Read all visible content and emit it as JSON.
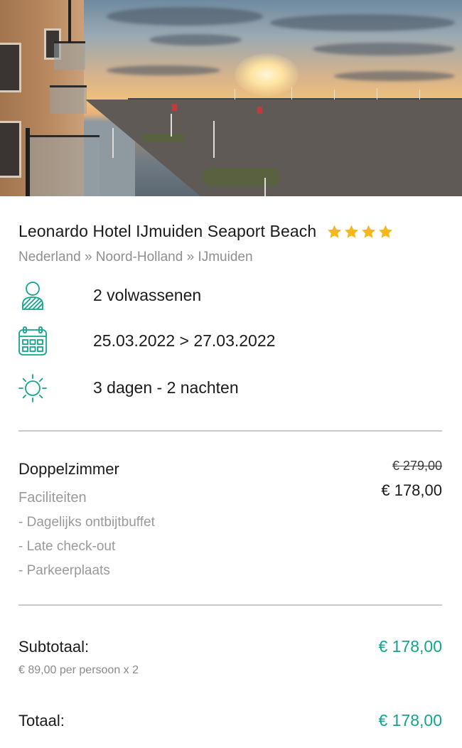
{
  "hotel": {
    "name": "Leonardo Hotel IJmuiden Seaport Beach",
    "stars": 4,
    "breadcrumb": "Nederland » Noord-Holland » IJmuiden"
  },
  "booking": {
    "guests": "2 volwassenen",
    "dates": "25.03.2022 > 27.03.2022",
    "duration": "3 dagen - 2 nachten"
  },
  "room": {
    "name": "Doppelzimmer",
    "old_price": "€ 279,00",
    "price": "€ 178,00",
    "facilities_title": "Faciliteiten",
    "facilities": [
      "- Dagelijks ontbijtbuffet",
      "- Late check-out",
      "- Parkeerplaats"
    ]
  },
  "summary": {
    "subtotal_label": "Subtotaal:",
    "subtotal_value": "€ 178,00",
    "per_person": "€ 89,00 per persoon x 2",
    "total_label": "Totaal:",
    "total_value": "€ 178,00"
  },
  "icons": {
    "guests": "person-icon",
    "dates": "calendar-icon",
    "duration": "sun-icon",
    "rating": "star-icon"
  },
  "colors": {
    "accent": "#13a58c",
    "star": "#f6b816",
    "muted_text": "#9a9a9a"
  }
}
